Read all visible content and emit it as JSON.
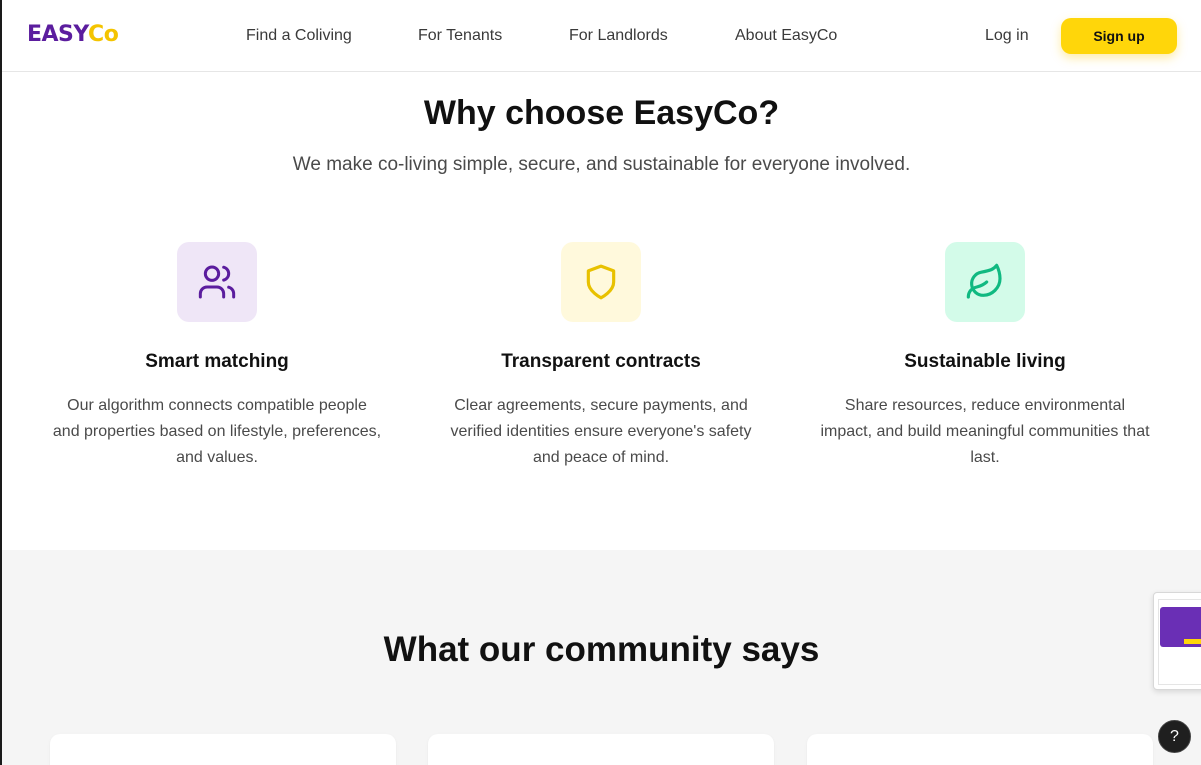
{
  "header": {
    "logo_part1": "EASY",
    "logo_part2": "Co",
    "nav": [
      "Find a Coliving",
      "For Tenants",
      "For Landlords",
      "About EasyCo"
    ],
    "login_label": "Log in",
    "signup_label": "Sign up"
  },
  "why": {
    "title": "Why choose EasyCo?",
    "subtitle": "We make co-living simple, secure, and sustainable for everyone involved.",
    "features": [
      {
        "icon": "users-icon",
        "title": "Smart matching",
        "text": "Our algorithm connects compatible people and properties based on lifestyle, preferences, and values."
      },
      {
        "icon": "shield-icon",
        "title": "Transparent contracts",
        "text": "Clear agreements, secure payments, and verified identities ensure everyone's safety and peace of mind."
      },
      {
        "icon": "leaf-icon",
        "title": "Sustainable living",
        "text": "Share resources, reduce environmental impact, and build meaningful communities that last."
      }
    ]
  },
  "community": {
    "title": "What our community says"
  },
  "help": {
    "label": "?"
  },
  "colors": {
    "brand_purple": "#5b1d9e",
    "brand_yellow": "#ffd60a",
    "icon_purple_bg": "#efe6f7",
    "icon_yellow_bg": "#fff9dc",
    "icon_green_bg": "#d3fbe9",
    "icon_green": "#10b981"
  }
}
